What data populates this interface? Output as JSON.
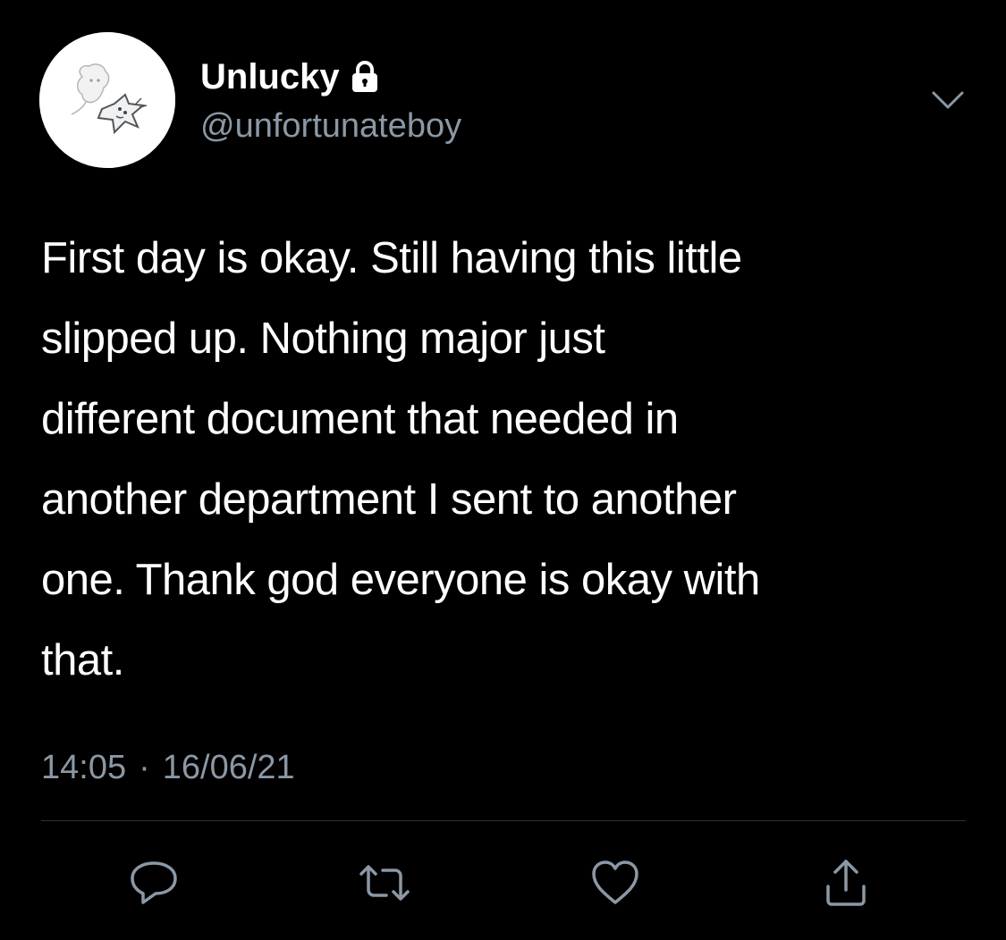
{
  "user": {
    "display_name": "Unlucky",
    "handle": "@unfortunateboy",
    "protected_icon": "lock-icon",
    "avatar_icon": "doodle-avatar"
  },
  "tweet": {
    "text_lines": [
      "First day is okay. Still having this little",
      "slipped up. Nothing major just",
      "different document that needed in",
      "another department I sent to another",
      "one. Thank god everyone is okay with",
      "that."
    ],
    "time": "14:05",
    "separator": "·",
    "date": "16/06/21"
  },
  "actions": {
    "reply_icon": "reply-icon",
    "retweet_icon": "retweet-icon",
    "like_icon": "heart-icon",
    "share_icon": "share-icon",
    "more_icon": "chevron-down-icon"
  },
  "colors": {
    "background": "#000000",
    "text": "#ffffff",
    "secondary_text": "#8b98a5",
    "divider": "#2f3336"
  }
}
